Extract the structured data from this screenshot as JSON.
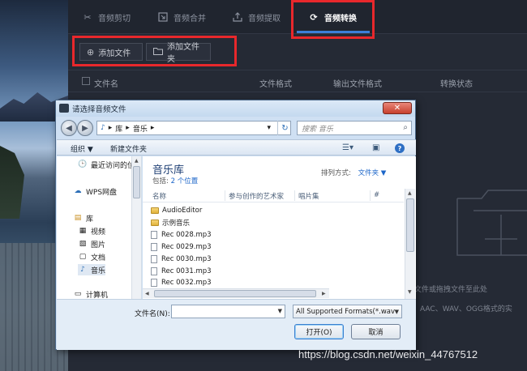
{
  "tabs": [
    {
      "label": "音频剪切",
      "icon": "scissors-icon"
    },
    {
      "label": "音频合并",
      "icon": "merge-icon"
    },
    {
      "label": "音频提取",
      "icon": "extract-icon"
    },
    {
      "label": "音频转换",
      "icon": "convert-icon",
      "active": true
    }
  ],
  "toolbar": {
    "add_file": "添加文件",
    "add_folder": "添加文件夹"
  },
  "list_header": {
    "name": "文件名",
    "format": "文件格式",
    "output_format": "输出文件格式",
    "status": "转换状态"
  },
  "drop_zone": {
    "line1": "文件或拖拽文件至此处",
    "line2": "AAC、WAV、OGG格式的实"
  },
  "watermark": "https://blog.csdn.net/weixin_44767512",
  "dialog": {
    "title": "请选择音频文件",
    "close": "✕",
    "address": {
      "part1": "库",
      "part2": "音乐"
    },
    "search_placeholder": "搜索 音乐",
    "commands": {
      "organize": "组织 ▼",
      "new_folder": "新建文件夹"
    },
    "nav": [
      {
        "label": "最近访问的位",
        "icon": "recent-icon"
      },
      {
        "label": "WPS网盘",
        "icon": "cloud-icon"
      },
      {
        "label": "库",
        "icon": "library-icon"
      },
      {
        "label": "视频",
        "icon": "video-icon"
      },
      {
        "label": "图片",
        "icon": "picture-icon"
      },
      {
        "label": "文档",
        "icon": "document-icon"
      },
      {
        "label": "音乐",
        "icon": "music-icon"
      },
      {
        "label": "计算机",
        "icon": "computer-icon"
      }
    ],
    "library": {
      "title": "音乐库",
      "includes_label": "包括:",
      "includes_link": "2 个位置",
      "arrange_label": "排列方式:",
      "arrange_value": "文件夹 ▼"
    },
    "columns": {
      "name": "名称",
      "artist": "参与创作的艺术家",
      "album": "唱片集",
      "track": "#"
    },
    "files": [
      {
        "name": "AudioEditor",
        "type": "folder"
      },
      {
        "name": "示例音乐",
        "type": "folder"
      },
      {
        "name": "Rec 0028.mp3",
        "type": "file"
      },
      {
        "name": "Rec 0029.mp3",
        "type": "file"
      },
      {
        "name": "Rec 0030.mp3",
        "type": "file"
      },
      {
        "name": "Rec 0031.mp3",
        "type": "file"
      },
      {
        "name": "Rec 0032.mp3",
        "type": "file"
      }
    ],
    "filename_label": "文件名(N):",
    "filename_value": "",
    "filter": "All Supported Formats(*.wav",
    "open": "打开(O)",
    "cancel": "取消"
  },
  "colors": {
    "accent": "#3b7fd9",
    "highlight": "#e8282c"
  }
}
